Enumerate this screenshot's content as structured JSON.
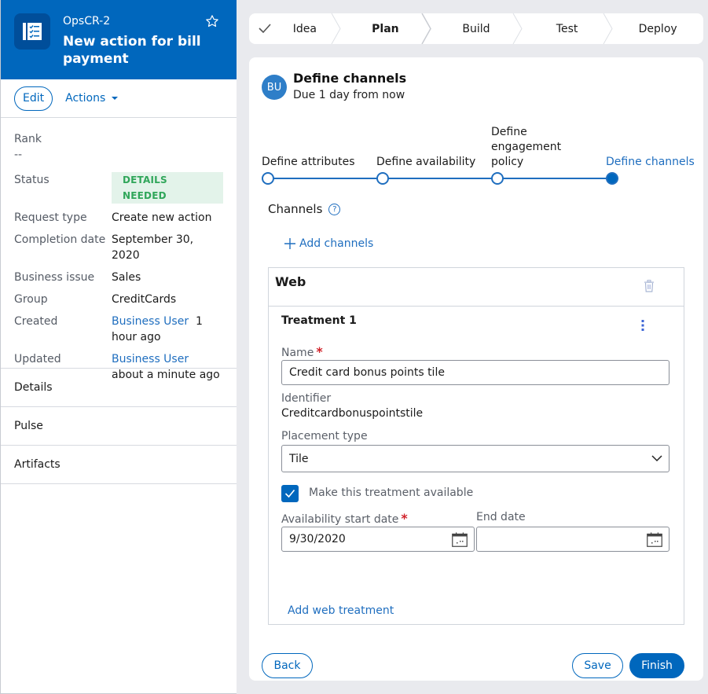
{
  "case": {
    "id": "OpsCR-2",
    "title": "New action for bill payment",
    "edit_label": "Edit",
    "actions_label": "Actions"
  },
  "summary": {
    "rank_label": "Rank",
    "rank_value": "--",
    "fields": [
      {
        "label": "Status",
        "value": "DETAILS NEEDED"
      },
      {
        "label": "Request type",
        "value": "Create new action"
      },
      {
        "label": "Completion date",
        "value": "September 30, 2020"
      },
      {
        "label": "Business issue",
        "value": "Sales"
      },
      {
        "label": "Group",
        "value": "CreditCards"
      },
      {
        "label": "Created",
        "user": "Business User",
        "value": "1 hour ago"
      },
      {
        "label": "Updated",
        "user": "Business User",
        "value": "about a minute ago"
      }
    ]
  },
  "nav": [
    {
      "label": "Details"
    },
    {
      "label": "Pulse"
    },
    {
      "label": "Artifacts"
    }
  ],
  "stages": [
    {
      "label": "Idea",
      "state": "completed"
    },
    {
      "label": "Plan",
      "state": "current"
    },
    {
      "label": "Build",
      "state": "future"
    },
    {
      "label": "Test",
      "state": "future"
    },
    {
      "label": "Deploy",
      "state": "future"
    }
  ],
  "assignment": {
    "avatar_initials": "BU",
    "title": "Define channels",
    "due": "Due 1 day from now"
  },
  "steps": [
    {
      "label": "Define attributes",
      "state": "done"
    },
    {
      "label": "Define availability",
      "state": "done"
    },
    {
      "label": "Define engagement policy",
      "state": "done"
    },
    {
      "label": "Define channels",
      "state": "current"
    }
  ],
  "channels": {
    "label": "Channels",
    "add_label": "Add channels",
    "channel_name": "Web",
    "treatment": {
      "title": "Treatment 1",
      "name_label": "Name",
      "name_value": "Credit card bonus points tile",
      "identifier_label": "Identifier",
      "identifier_value": "Creditcardbonuspointstile",
      "placement_label": "Placement type",
      "placement_value": "Tile",
      "available_label": "Make this treatment available",
      "available_checked": true,
      "start_label": "Availability start date",
      "start_value": "9/30/2020",
      "end_label": "End date",
      "end_value": ""
    },
    "add_treatment_label": "Add web treatment"
  },
  "buttons": {
    "back": "Back",
    "save": "Save",
    "finish": "Finish"
  },
  "colors": {
    "brand": "#0067bd",
    "link": "#1f6ebf",
    "status_bg": "#e3f3ea",
    "status_text": "#30a65a",
    "required": "#d1222a"
  }
}
